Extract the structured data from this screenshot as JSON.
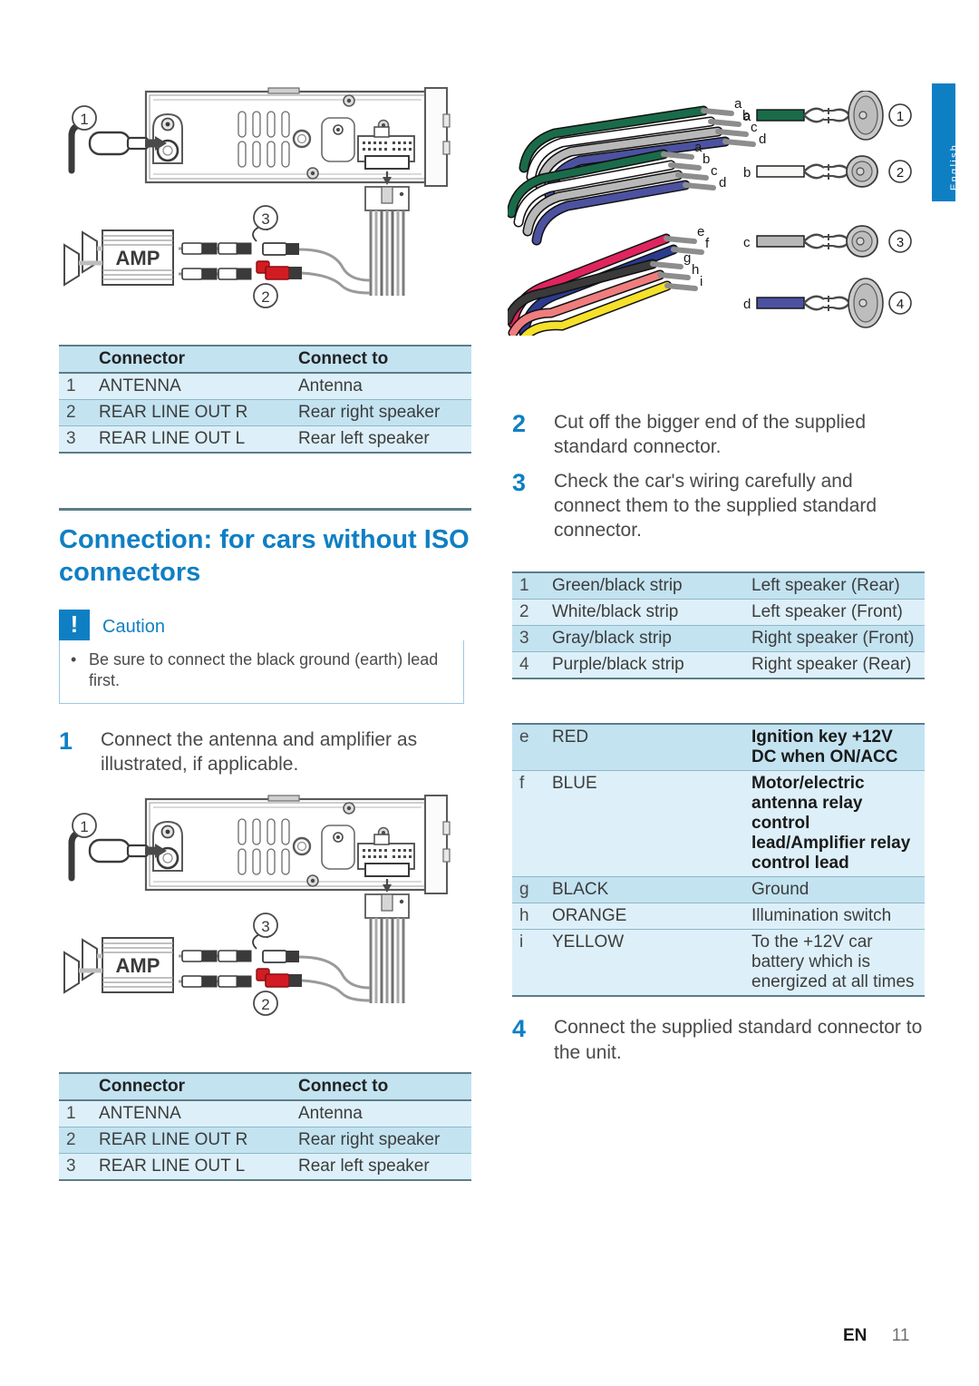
{
  "language_tab": "English",
  "footer": {
    "lang_code": "EN",
    "page_number": "11"
  },
  "connector_table": {
    "headers": [
      "",
      "Connector",
      "Connect to"
    ],
    "rows": [
      {
        "num": "1",
        "connector": "ANTENNA",
        "connect_to": "Antenna"
      },
      {
        "num": "2",
        "connector": "REAR LINE OUT R",
        "connect_to": "Rear right speaker"
      },
      {
        "num": "3",
        "connector": "REAR LINE OUT L",
        "connect_to": "Rear left speaker"
      }
    ]
  },
  "section": {
    "title": "Connection: for cars without ISO connectors",
    "caution_label": "Caution",
    "caution_icon": "exclamation-icon",
    "caution_items": [
      "Be sure to connect the black ground (earth) lead first."
    ]
  },
  "steps": {
    "step1": {
      "num": "1",
      "text": "Connect the antenna and amplifier as illustrated, if applicable."
    },
    "step2": {
      "num": "2",
      "text": "Cut off the bigger end of the supplied standard connector."
    },
    "step3": {
      "num": "3",
      "text": "Check the car's wiring carefully and connect them to the supplied standard connector."
    },
    "step4": {
      "num": "4",
      "text": "Connect the supplied standard connector to the unit."
    }
  },
  "speaker_wire_table": {
    "rows": [
      {
        "num": "1",
        "wire": "Green/black strip",
        "target": "Left speaker (Rear)"
      },
      {
        "num": "2",
        "wire": "White/black strip",
        "target": "Left speaker (Front)"
      },
      {
        "num": "3",
        "wire": "Gray/black strip",
        "target": "Right speaker (Front)"
      },
      {
        "num": "4",
        "wire": "Purple/black strip",
        "target": "Right speaker (Rear)"
      }
    ]
  },
  "power_wire_table": {
    "rows": [
      {
        "letter": "e",
        "color": "RED",
        "desc": "Ignition key +12V DC when ON/ACC",
        "bold": true
      },
      {
        "letter": "f",
        "color": "BLUE",
        "desc": "Motor/electric antenna relay control lead/Amplifier relay control lead",
        "bold": true
      },
      {
        "letter": "g",
        "color": "BLACK",
        "desc": "Ground",
        "bold": false
      },
      {
        "letter": "h",
        "color": "ORANGE",
        "desc": "Illumination switch",
        "bold": false
      },
      {
        "letter": "i",
        "color": "YELLOW",
        "desc": "To the +12V car battery which is energized at all times",
        "bold": false
      }
    ]
  },
  "diagram_top": {
    "amp_label": "AMP",
    "callouts": [
      "1",
      "2",
      "3"
    ]
  },
  "diagram_bottom": {
    "amp_label": "AMP",
    "callouts": [
      "1",
      "2",
      "3"
    ]
  },
  "harness_diagram": {
    "bundle1_labels": [
      "a",
      "b",
      "c",
      "d"
    ],
    "bundle2_labels": [
      "a",
      "b",
      "c",
      "d"
    ],
    "bundle3_labels": [
      "e",
      "f",
      "g",
      "h",
      "i"
    ],
    "speaker_rows": [
      {
        "letter": "a",
        "wire_color": "#1a6b4a",
        "callout": "1",
        "speaker": "oval"
      },
      {
        "letter": "b",
        "wire_color": "#f4f4f2",
        "callout": "2",
        "speaker": "round"
      },
      {
        "letter": "c",
        "wire_color": "#b8b8b8",
        "callout": "3",
        "speaker": "round"
      },
      {
        "letter": "d",
        "wire_color": "#4c52a0",
        "callout": "4",
        "speaker": "oval"
      }
    ],
    "wire_colors": {
      "green": "#1a6b4a",
      "white": "#ffffff",
      "gray": "#b0b0b0",
      "purple": "#4c52a0",
      "red": "#e0245e",
      "blue": "#2a3b8f",
      "black": "#3a3a3a",
      "orange": "#ef7d7d",
      "yellow": "#f5e02a"
    }
  },
  "colors": {
    "accent": "#0f7fc4",
    "table_dark": "#c3e3f1",
    "table_light": "#ddf0f9",
    "rule": "#5b7d88"
  }
}
